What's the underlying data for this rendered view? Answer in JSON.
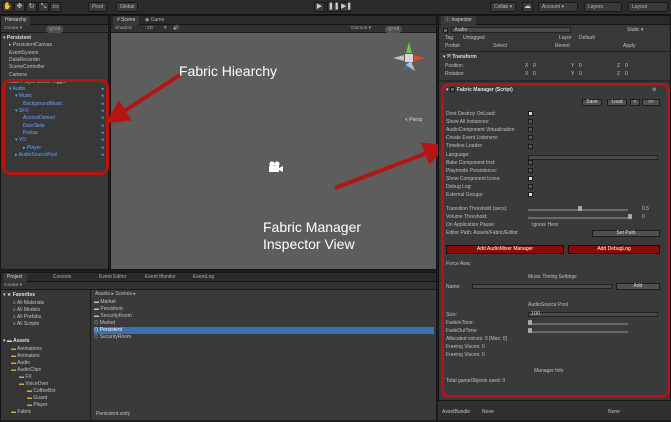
{
  "toolbar": {
    "pivot": "Pivot",
    "global": "Global",
    "collab": "Collab ▾",
    "account": "Account ▾",
    "layers": "Layers",
    "layout": "Layout"
  },
  "hierarchy": {
    "tab": "Hierarchy",
    "create": "Create ▾",
    "search": "Q*All",
    "items": [
      {
        "label": "Persistent",
        "style": "bold"
      },
      {
        "label": "PersistentCanvas",
        "style": "normal"
      },
      {
        "label": "EventSystem",
        "style": "normal"
      },
      {
        "label": "DataRecorder",
        "style": "normal"
      },
      {
        "label": "SceneController",
        "style": "normal"
      },
      {
        "label": "Camera",
        "style": "normal"
      },
      {
        "label": "Main Player Event Trigger",
        "style": "normal"
      },
      {
        "label": "Audio",
        "style": "blue"
      },
      {
        "label": "Music",
        "style": "blue"
      },
      {
        "label": "BackgroundMusic",
        "style": "blue"
      },
      {
        "label": "SFX",
        "style": "blue"
      },
      {
        "label": "AccessDenied",
        "style": "blue"
      },
      {
        "label": "DoorSlide",
        "style": "blue"
      },
      {
        "label": "Pickup",
        "style": "blue"
      },
      {
        "label": "VO",
        "style": "blue"
      },
      {
        "label": "Player",
        "style": "blue"
      },
      {
        "label": "AudioSourcePool",
        "style": "blue"
      }
    ]
  },
  "scene": {
    "tab_scene": "Scene",
    "tab_game": "Game",
    "shaded": "Shaded",
    "mode_2d": "2D",
    "gizmos": "Gizmos ▾",
    "search": "Q*All",
    "persp": "< Persp"
  },
  "callouts": {
    "hierarchy": "Fabric Hiearchy",
    "inspector_line1": "Fabric Manager",
    "inspector_line2": "Inspector View"
  },
  "inspector": {
    "tab": "Inspector",
    "object_name": "Audio",
    "static": "Static ▾",
    "tag_label": "Tag",
    "tag_value": "Untagged",
    "layer_label": "Layer",
    "layer_value": "Default",
    "prefab_label": "Prefab",
    "prefab_select": "Select",
    "prefab_revert": "Revert",
    "prefab_apply": "Apply",
    "transform_title": "Transform",
    "position": "Position",
    "rotation": "Rotation",
    "x": "X",
    "y": "Y",
    "z": "Z",
    "pos_vals": [
      "0",
      "0",
      "0"
    ],
    "rot_vals": [
      "0",
      "0",
      "0"
    ],
    "component_title": "Fabric Manager (Script)",
    "save": "Save",
    "load": "Load",
    "prev": "<",
    "next": ">>",
    "props": [
      {
        "label": "Dont Destroy OnLoad:",
        "checked": true
      },
      {
        "label": "Show All Instances:",
        "checked": false
      },
      {
        "label": "AudioComponent Virtualization",
        "checked": false
      },
      {
        "label": "Create Event Listeners:",
        "checked": false
      },
      {
        "label": "Timeline Loader:",
        "checked": false
      },
      {
        "label": "Language:",
        "checked": null
      },
      {
        "label": "Bake Component Inst:",
        "checked": false
      },
      {
        "label": "Playmode Persistence:",
        "checked": false
      },
      {
        "label": "Show Component Icons:",
        "checked": true
      },
      {
        "label": "Debug Log:",
        "checked": false
      },
      {
        "label": "External Groups:",
        "checked": true
      }
    ],
    "transition_label": "Transition Threshold (secs):",
    "transition_value": "0.5",
    "volume_label": "Volume Threshold:",
    "volume_value": "0",
    "on_app_pause_label": "On Application Pause:",
    "on_app_pause_value": "Ignore Here",
    "editor_path_label": "Editor Path: Assets/Fabric/Editor",
    "set_path": "Set Path",
    "add_mixer": "Add AudioMixer Manager",
    "add_debug": "Add DebugLog",
    "force_awake": "Force Awa:",
    "music_timing": "Music Timing Settings",
    "name_label": "Name:",
    "add": "Add",
    "pool_title": "AudioSource Pool",
    "size_label": "Size:",
    "size_value": "100",
    "fadein_label": "FadeInTime:",
    "fadeout_label": "FadeOutTime:",
    "allocated": "Allocated voices: 0   [Max: 0]",
    "freeing": "Freeing Voices: 0",
    "freeing2": "Freeing Voices: 0",
    "manager_info": "Manager Info",
    "total": "Total gameObjects used: 0",
    "assetbundle_label": "AssetBundle",
    "assetbundle_value": "None",
    "assetbundle_value2": "None"
  },
  "project": {
    "tabs": [
      "Project",
      "Console",
      "Event Editor",
      "Event Monitor",
      "EventLog"
    ],
    "create": "Create ▾",
    "favorites": "Favorites",
    "fav_items": [
      "All Materials",
      "All Models",
      "All Prefabs",
      "All Scripts"
    ],
    "assets": "Assets",
    "tree": [
      "Animations",
      "Animators",
      "Audio",
      "AudioClips",
      "FX",
      "VoiceOver",
      "CoffeeBot",
      "Guard",
      "Player",
      "Fabric"
    ],
    "breadcrumb": "Assets ▸ Scenes ▸",
    "files": [
      "Market",
      "Persistent",
      "SecurityRoom",
      "Market",
      "Persistent",
      "SecurityRoom"
    ],
    "selected_file_index": 4,
    "footer": "Persistent.unity"
  }
}
